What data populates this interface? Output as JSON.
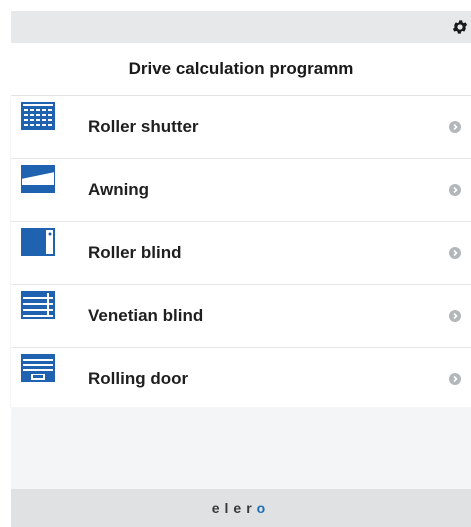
{
  "header": {
    "title": "Drive calculation programm"
  },
  "items": [
    {
      "label": "Roller shutter",
      "icon": "roller-shutter-icon"
    },
    {
      "label": "Awning",
      "icon": "awning-icon"
    },
    {
      "label": "Roller blind",
      "icon": "roller-blind-icon"
    },
    {
      "label": "Venetian blind",
      "icon": "venetian-blind-icon"
    },
    {
      "label": "Rolling door",
      "icon": "rolling-door-icon"
    }
  ],
  "footer": {
    "logo_text": "eler",
    "logo_accent": "o"
  },
  "colors": {
    "icon_blue": "#1f62b0",
    "topbar": "#e6e8ea",
    "footer": "#dfe1e3"
  }
}
